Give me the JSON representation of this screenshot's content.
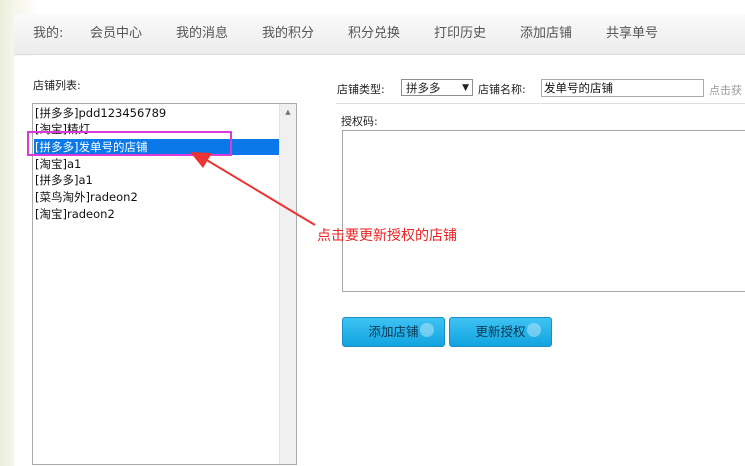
{
  "nav": {
    "items": [
      "我的:",
      "会员中心",
      "我的消息",
      "我的积分",
      "积分兑换",
      "打印历史",
      "添加店铺",
      "共享单号"
    ]
  },
  "shop_list": {
    "label": "店铺列表:",
    "items": [
      "[拼多多]pdd123456789",
      "[淘宝]精灯",
      "[拼多多]发单号的店铺",
      "[淘宝]a1",
      "[拼多多]a1",
      "[菜鸟淘外]radeon2",
      "[淘宝]radeon2"
    ],
    "selected_index": 2
  },
  "form": {
    "shop_type_label": "店铺类型:",
    "shop_type_value": "拼多多",
    "shop_name_label": "店铺名称:",
    "shop_name_value": "发单号的店铺",
    "fetch_hint": "点击获",
    "auth_code_label": "授权码:",
    "auth_code_value": ""
  },
  "buttons": {
    "add_shop": "添加店铺",
    "update_auth": "更新授权"
  },
  "annotation": {
    "text": "点击要更新授权的店铺",
    "color": "#ee2222",
    "highlight_color": "#d93ad9"
  },
  "colors": {
    "selection": "#0a78e8",
    "button": "#1aaae6"
  }
}
